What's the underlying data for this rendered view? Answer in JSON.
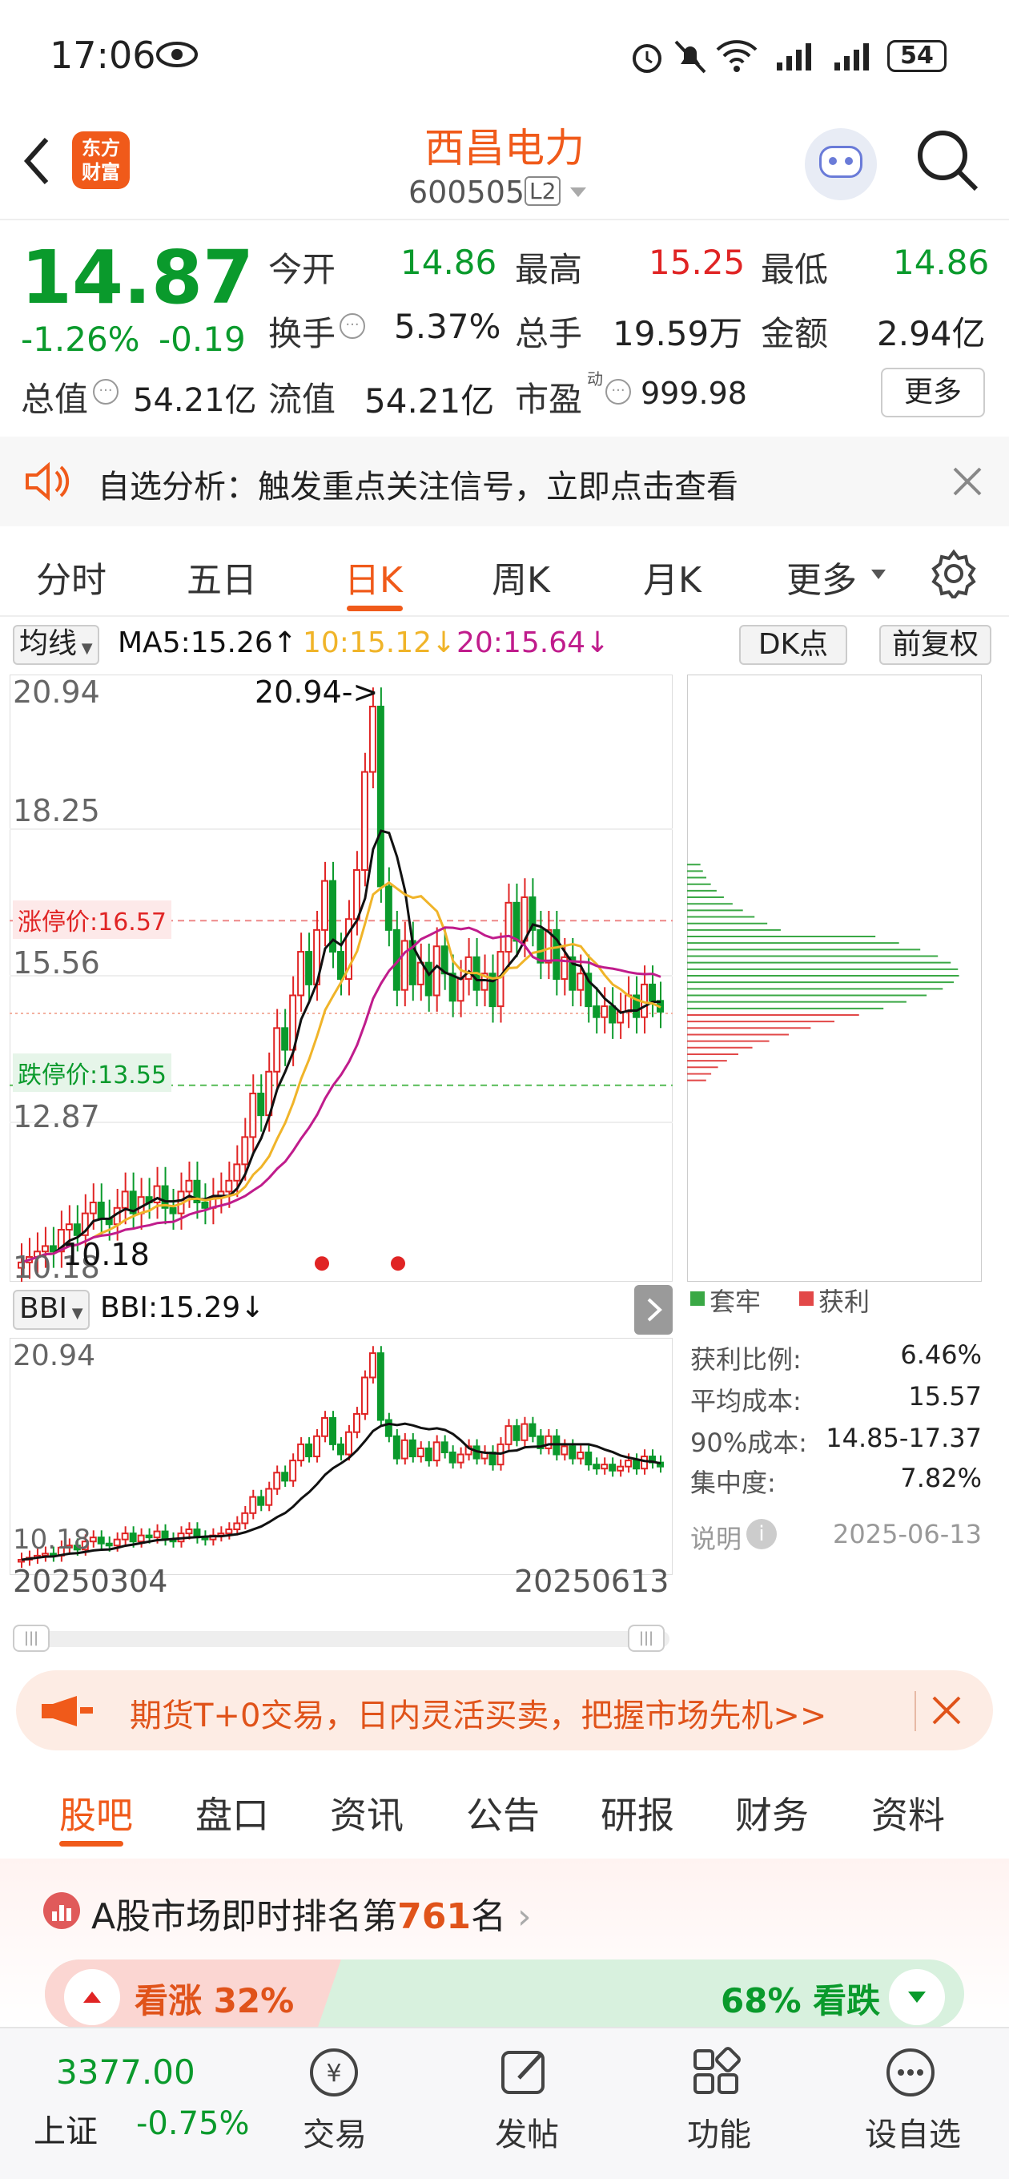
{
  "status": {
    "time": "17:06",
    "battery": "54"
  },
  "header": {
    "logo_line1": "东方",
    "logo_line2": "财富",
    "title": "西昌电力",
    "code": "600505",
    "level": "L2"
  },
  "quote": {
    "price": "14.87",
    "change_pct": "-1.26%",
    "change": "-0.19",
    "open_label": "今开",
    "open": "14.86",
    "high_label": "最高",
    "high": "15.25",
    "low_label": "最低",
    "low": "14.86",
    "turnover_label": "换手",
    "turnover": "5.37%",
    "volume_label": "总手",
    "volume": "19.59万",
    "amount_label": "金额",
    "amount": "2.94亿",
    "mktcap_label": "总值",
    "mktcap": "54.21亿",
    "float_label": "流值",
    "float": "54.21亿",
    "pe_label": "市盈",
    "pe_sup": "动",
    "pe": "999.98",
    "more": "更多"
  },
  "notice": {
    "text": "自选分析：触发重点关注信号，立即点击查看"
  },
  "tabs": [
    "分时",
    "五日",
    "日K",
    "周K",
    "月K",
    "更多"
  ],
  "active_tab": "日K",
  "chart": {
    "ma_selector": "均线",
    "ma5": "MA5:15.26↑",
    "ma10": "10:15.12↓",
    "ma20": "20:15.64↓",
    "dk_button": "DK点",
    "adjust_button": "前复权",
    "y_top": "20.94",
    "y_2": "18.25",
    "y_3": "15.56",
    "y_4": "12.87",
    "y_bottom": "10.18",
    "peak_label": "20.94->",
    "low_label": "10.18",
    "limit_up": "涨停价:16.57",
    "limit_down": "跌停价:13.55",
    "bbi_selector": "BBI",
    "bbi_value": "BBI:15.29↓",
    "sub_top": "20.94",
    "sub_bottom": "10.18",
    "date_start": "20250304",
    "date_end": "20250613",
    "colors": {
      "up": "#e02424",
      "down": "#0a9a2c",
      "ma5": "#111111",
      "ma10": "#f0b429",
      "ma20": "#c01c8c"
    }
  },
  "chip": {
    "legend_trapped": "套牢",
    "legend_profit": "获利",
    "rows": [
      {
        "label": "获利比例:",
        "value": "6.46%"
      },
      {
        "label": "平均成本:",
        "value": "15.57"
      },
      {
        "label": "90%成本:",
        "value": "14.85-17.37"
      },
      {
        "label": "集中度:",
        "value": "7.82%"
      }
    ],
    "explain": "说明",
    "date": "2025-06-13"
  },
  "banner": {
    "text": "期货T+0交易，日内灵活买卖，把握市场先机>>"
  },
  "subtabs": [
    "股吧",
    "盘口",
    "资讯",
    "公告",
    "研报",
    "财务",
    "资料"
  ],
  "rank": {
    "prefix": "A股市场即时排名第",
    "number": "761",
    "suffix": "名",
    "bull": "看涨 32%",
    "bear": "68% 看跌"
  },
  "bottom": {
    "index_value": "3377.00",
    "index_name": "上证",
    "index_change": "-0.75%",
    "items": [
      "交易",
      "发帖",
      "功能",
      "设自选"
    ]
  }
}
